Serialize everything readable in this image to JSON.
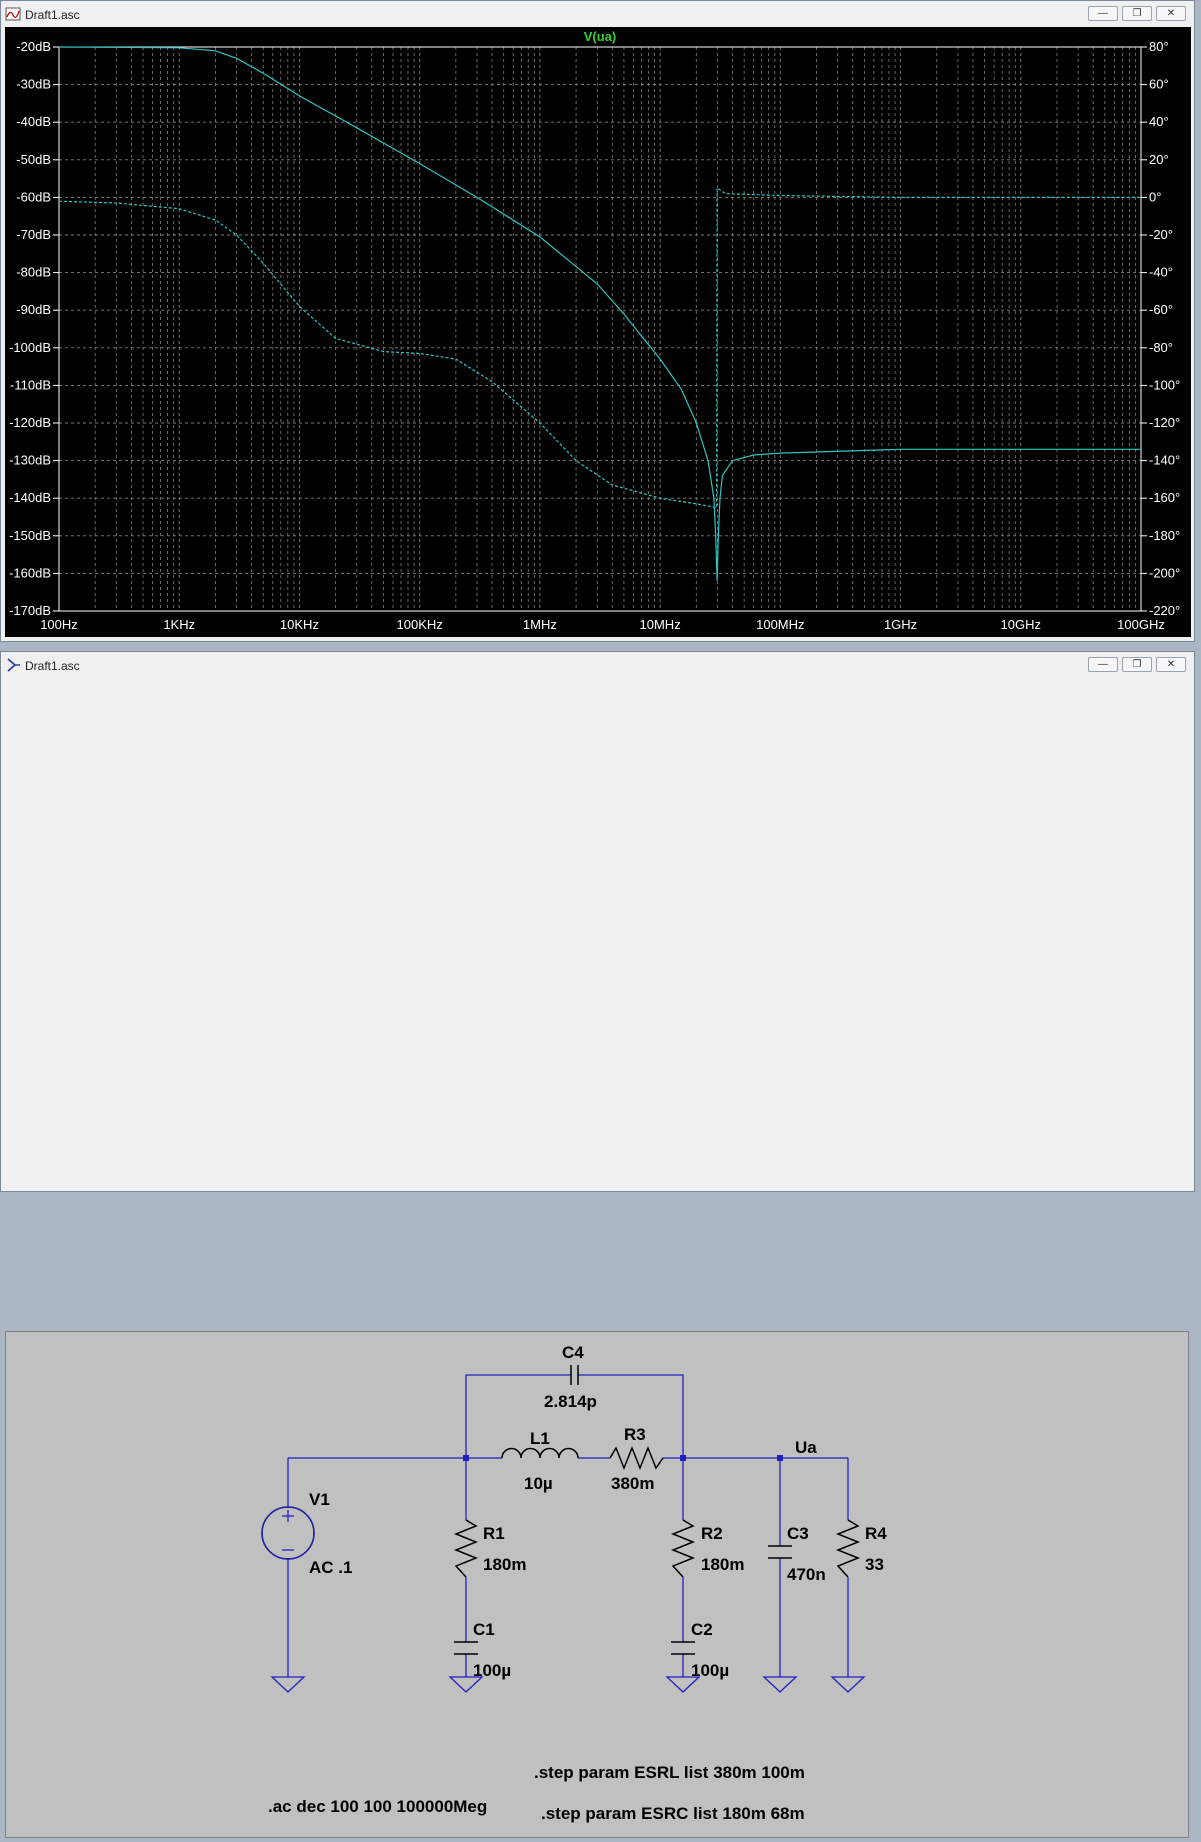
{
  "plot_window": {
    "title": "Draft1.asc",
    "icon": "waveform-icon",
    "controls": [
      "minimize",
      "restore",
      "close"
    ]
  },
  "schematic_window": {
    "title": "Draft1.asc",
    "icon": "schematic-icon",
    "controls": [
      "minimize",
      "restore",
      "close"
    ]
  },
  "colors": {
    "plot_bg": "#000000",
    "grid": "#808080",
    "axis_text": "#ffffff",
    "trace": "#2ec4c4",
    "trace_label": "#37d037",
    "wire": "#2020c0",
    "component": "#000000",
    "schematic_bg": "#c0c0c0"
  },
  "chart_data": {
    "type": "line",
    "title": "V(ua)",
    "x_scale": "log",
    "x_ticks": [
      "100Hz",
      "1KHz",
      "10KHz",
      "100KHz",
      "1MHz",
      "10MHz",
      "100MHz",
      "1GHz",
      "10GHz",
      "100GHz"
    ],
    "x_tick_values": [
      100,
      1000,
      10000,
      100000,
      1000000,
      10000000,
      100000000,
      1000000000,
      10000000000,
      100000000000
    ],
    "xlim": [
      100,
      100000000000
    ],
    "y_left_ticks": [
      "-20dB",
      "-30dB",
      "-40dB",
      "-50dB",
      "-60dB",
      "-70dB",
      "-80dB",
      "-90dB",
      "-100dB",
      "-110dB",
      "-120dB",
      "-130dB",
      "-140dB",
      "-150dB",
      "-160dB",
      "-170dB"
    ],
    "ylim_left": [
      -170,
      -20
    ],
    "y_right_ticks": [
      "80°",
      "60°",
      "40°",
      "20°",
      "0°",
      "-20°",
      "-40°",
      "-60°",
      "-80°",
      "-100°",
      "-120°",
      "-140°",
      "-160°",
      "-180°",
      "-200°",
      "-220°"
    ],
    "ylim_right": [
      -220,
      80
    ],
    "grid": true,
    "series": [
      {
        "name": "V(ua)",
        "axis": "left",
        "style": "solid",
        "points": [
          [
            100,
            -20
          ],
          [
            1000,
            -20.2
          ],
          [
            2000,
            -21
          ],
          [
            3000,
            -23
          ],
          [
            5000,
            -27
          ],
          [
            10000,
            -33
          ],
          [
            30000,
            -41.5
          ],
          [
            100000,
            -51
          ],
          [
            300000,
            -60
          ],
          [
            1000000,
            -70.5
          ],
          [
            3000000,
            -83
          ],
          [
            5000000,
            -91
          ],
          [
            10000000,
            -103
          ],
          [
            15000000,
            -111
          ],
          [
            20000000,
            -120
          ],
          [
            25000000,
            -130
          ],
          [
            28000000,
            -140
          ],
          [
            29000000,
            -150
          ],
          [
            29800000,
            -162
          ],
          [
            30500000,
            -150
          ],
          [
            31500000,
            -140
          ],
          [
            33000000,
            -134
          ],
          [
            40000000,
            -130
          ],
          [
            60000000,
            -128.5
          ],
          [
            100000000,
            -128
          ],
          [
            1000000000,
            -127
          ],
          [
            100000000000,
            -127
          ]
        ]
      },
      {
        "name": "V(ua) phase",
        "axis": "right",
        "style": "dashed",
        "points": [
          [
            100,
            -2
          ],
          [
            300,
            -3
          ],
          [
            1000,
            -6
          ],
          [
            2000,
            -12
          ],
          [
            3000,
            -20
          ],
          [
            5000,
            -35
          ],
          [
            10000,
            -58
          ],
          [
            20000,
            -75
          ],
          [
            50000,
            -82
          ],
          [
            100000,
            -83
          ],
          [
            200000,
            -86
          ],
          [
            400000,
            -98
          ],
          [
            1000000,
            -120
          ],
          [
            2000000,
            -140
          ],
          [
            4000000,
            -153
          ],
          [
            10000000,
            -160
          ],
          [
            20000000,
            -163
          ],
          [
            29500000,
            -165
          ],
          [
            29800000,
            5
          ],
          [
            35000000,
            2
          ],
          [
            100000000,
            1
          ],
          [
            1000000000,
            0
          ],
          [
            100000000000,
            0
          ]
        ]
      }
    ]
  },
  "schematic": {
    "components": [
      {
        "ref": "V1",
        "value": "AC .1",
        "kind": "voltage-source"
      },
      {
        "ref": "C4",
        "value": "2.814p",
        "kind": "capacitor"
      },
      {
        "ref": "L1",
        "value": "10µ",
        "kind": "inductor"
      },
      {
        "ref": "R3",
        "value": "380m",
        "kind": "resistor"
      },
      {
        "ref": "R1",
        "value": "180m",
        "kind": "resistor"
      },
      {
        "ref": "C1",
        "value": "100µ",
        "kind": "capacitor"
      },
      {
        "ref": "R2",
        "value": "180m",
        "kind": "resistor"
      },
      {
        "ref": "C2",
        "value": "100µ",
        "kind": "capacitor"
      },
      {
        "ref": "C3",
        "value": "470n",
        "kind": "capacitor"
      },
      {
        "ref": "R4",
        "value": "33",
        "kind": "resistor"
      }
    ],
    "net_label": "Ua",
    "directives": {
      "ac": ".ac dec 100 100 100000Meg",
      "step1": ".step param ESRL list 380m 100m",
      "step2": ".step param ESRC list 180m 68m"
    }
  }
}
